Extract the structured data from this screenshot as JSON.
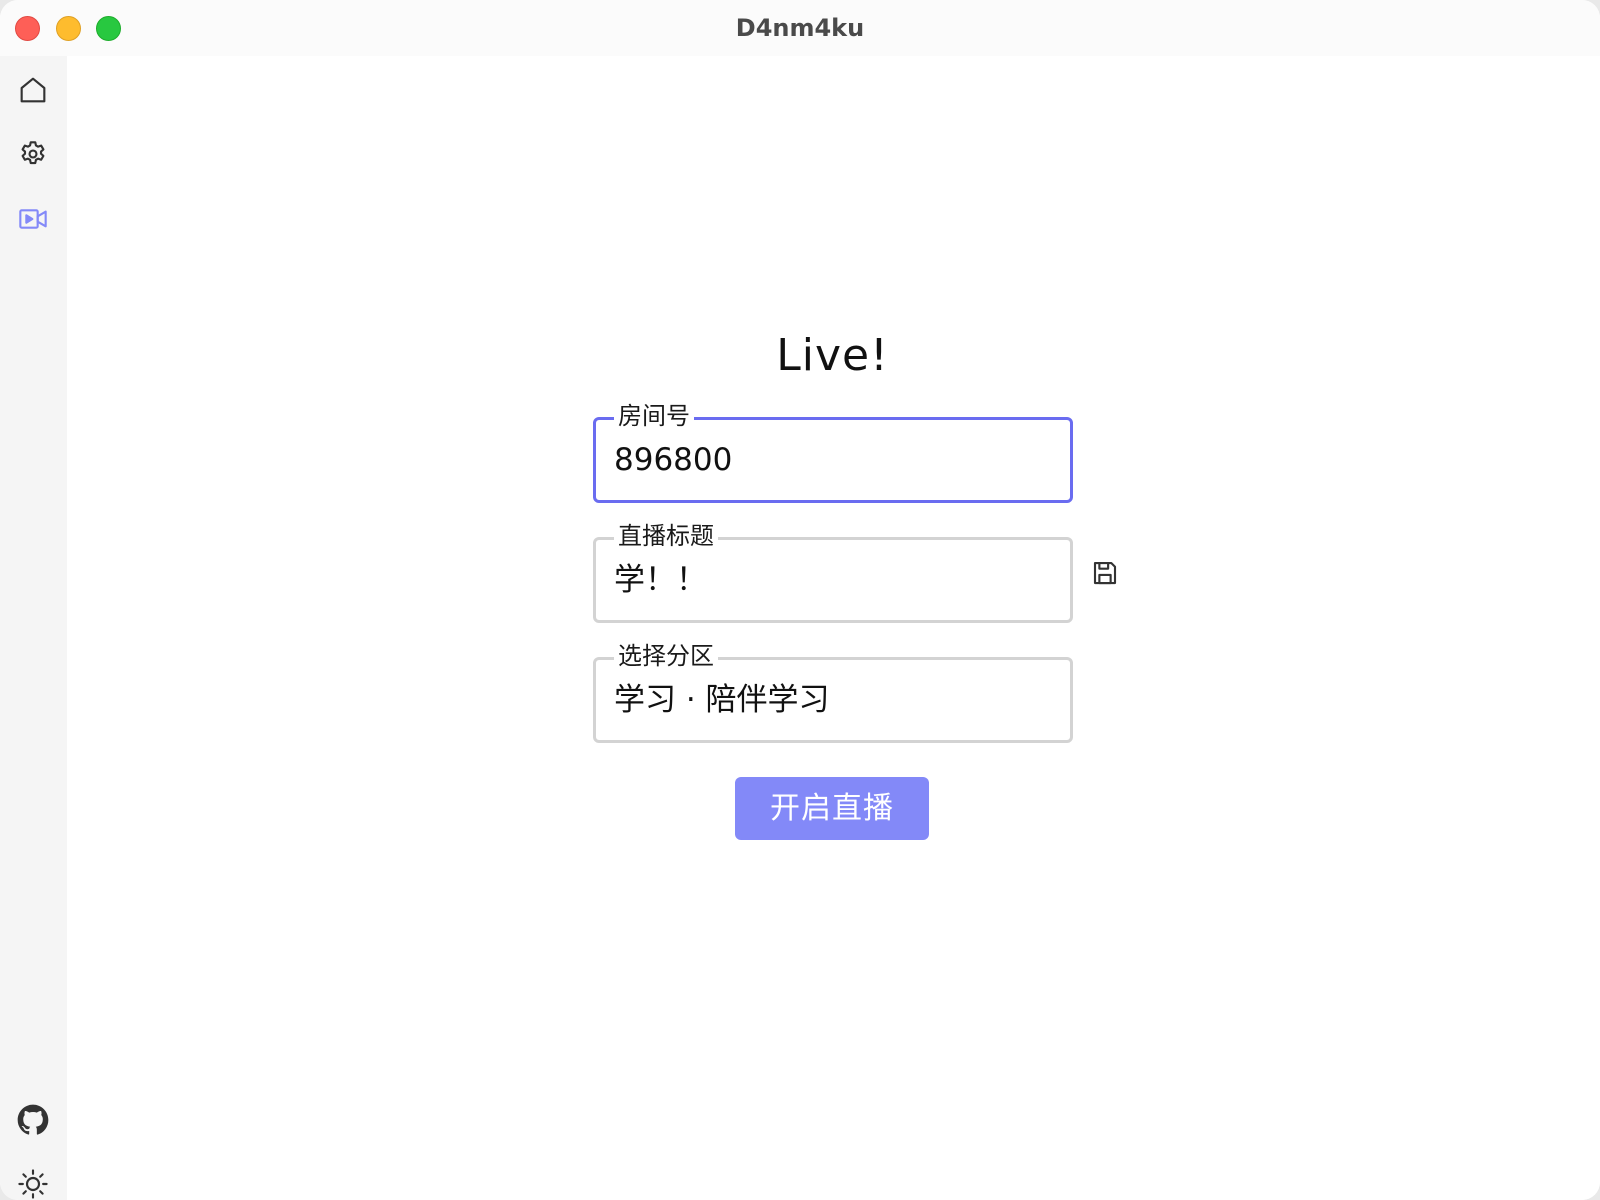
{
  "window": {
    "title": "D4nm4ku"
  },
  "sidebar": {
    "top_items": [
      {
        "icon": "home-icon"
      },
      {
        "icon": "gear-icon"
      },
      {
        "icon": "video-camera-icon",
        "active": true
      }
    ],
    "bottom_items": [
      {
        "icon": "github-icon"
      },
      {
        "icon": "sun-icon"
      }
    ],
    "active_color": "#8389f8"
  },
  "main": {
    "heading": "Live!",
    "room_field": {
      "label": "房间号",
      "value": "896800"
    },
    "title_field": {
      "label": "直播标题",
      "value": "学！！",
      "save_icon": "save-icon"
    },
    "area_field": {
      "label": "选择分区",
      "value": "学习 · 陪伴学习"
    },
    "start_button": {
      "label": "开启直播"
    }
  },
  "colors": {
    "accent": "#6a6cf0",
    "button": "#8389f8",
    "field_border": "#d3d3d3"
  }
}
